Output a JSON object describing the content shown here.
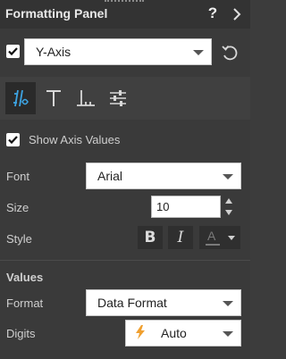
{
  "header": {
    "title": "Formatting Panel",
    "help": "?"
  },
  "axis": {
    "selected": "Y-Axis",
    "checked": true
  },
  "tabs": [
    {
      "name": "axis-format",
      "active": true
    },
    {
      "name": "text",
      "active": false
    },
    {
      "name": "axis-lines",
      "active": false
    },
    {
      "name": "settings",
      "active": false
    }
  ],
  "show_axis_values": {
    "label": "Show Axis Values",
    "checked": true
  },
  "font": {
    "label": "Font",
    "value": "Arial"
  },
  "size": {
    "label": "Size",
    "value": "10"
  },
  "style": {
    "label": "Style",
    "bold": "B",
    "italic": "I",
    "color_letter": "A"
  },
  "values": {
    "title": "Values",
    "format": {
      "label": "Format",
      "value": "Data Format"
    },
    "digits": {
      "label": "Digits",
      "value": "Auto"
    }
  },
  "colors": {
    "accent": "#3da4e3",
    "bolt": "#f0a030"
  }
}
